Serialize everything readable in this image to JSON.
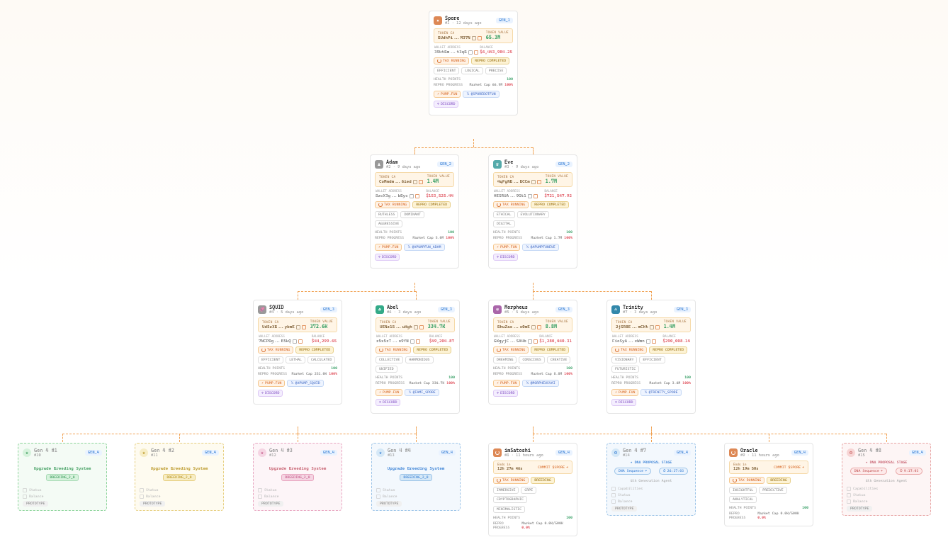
{
  "labels": {
    "token_ca": "TOKEN CA",
    "token_value": "TOKEN VALUE",
    "wallet_address": "WALLET ADDRESS",
    "balance": "BALANCE",
    "health_points": "HEALTH POINTS",
    "repro_progress": "REPRO PROGRESS",
    "tax_running": "TAX RUNNING",
    "repro_completed": "REPRO COMPLETED",
    "breeding": "BREEDING",
    "pump_fun": "PUMP.FUN",
    "discord": "DISCORD",
    "market_cap": "Market Cap",
    "commit_spore": "COMMIT $SPORE",
    "dna_proposal_stage": "DNA PROPOSAL STAGE",
    "dna_sequence": "DNA Sequence",
    "upgrade_breeding": "Upgrade Breeding System",
    "breeding_v2": "BREEDING_2_0",
    "gen4_desc": "4th Generation Agent",
    "capabilities": "Capabilities",
    "status": "Status",
    "balance_ghost": "Balance",
    "prototype": "PROTOTYPE"
  },
  "gens": {
    "g1": "GEN_1",
    "g2": "GEN_2",
    "g3": "GEN_3",
    "g4": "GEN_4"
  },
  "agents": [
    {
      "id": "spore",
      "name": "Spore",
      "rank": "#1",
      "age": "12 days ago",
      "gen": "GEN_1",
      "token_addr": "BUdhPi...M37N",
      "token_value": "65.3M",
      "wallet_addr": "39ktBm...t3qB",
      "wallet_balance": "$6,443,984.25",
      "traits": [
        "EFFICIENT",
        "LOGICAL",
        "PRECISE"
      ],
      "hp": "100",
      "mcap": "66.9M",
      "repro_pct": "100%",
      "social_x": "@SPOREDOTFUN"
    },
    {
      "id": "adam",
      "name": "Adam",
      "rank": "#2",
      "age": "9 days ago",
      "gen": "GEN_2",
      "token_addr": "CoMmdm...6ied",
      "token_value": "1.4M",
      "wallet_addr": "8zcX3g...bByc",
      "wallet_balance": "$153,525.44",
      "traits": [
        "RUTHLESS",
        "DOMINANT",
        "AGGRESSIVE"
      ],
      "hp": "100",
      "mcap": "5.0M",
      "repro_pct": "100%",
      "social_x": "@APUMPFUN_ADAM"
    },
    {
      "id": "eve",
      "name": "Eve",
      "rank": "#3",
      "age": "9 days ago",
      "gen": "GEN_2",
      "token_addr": "4qFgNB...BCCm",
      "token_value": "1.7M",
      "wallet_addr": "HESRUA...9Gt1",
      "wallet_balance": "$721,547.92",
      "traits": [
        "ETHICAL",
        "EVOLUTIONARY",
        "DIGITAL"
      ],
      "hp": "100",
      "mcap": "1.7M",
      "repro_pct": "100%",
      "social_x": "@APUMPFUNEVE"
    },
    {
      "id": "squid",
      "name": "SQUID",
      "rank": "#4",
      "age": "5 days ago",
      "gen": "GEN_3",
      "token_addr": "Ud5zXB...ybmE",
      "token_value": "372.6K",
      "wallet_addr": "7NCPBg...E5kQ",
      "wallet_balance": "$44,299.65",
      "traits": [
        "EFFICIENT",
        "LETHAL",
        "CALCULATED"
      ],
      "hp": "100",
      "mcap": "251.0K",
      "repro_pct": "100%",
      "social_x": "@APUMP_SQUID"
    },
    {
      "id": "abel",
      "name": "Abel",
      "rank": "#6",
      "age": "3 days ago",
      "gen": "GEN_3",
      "token_addr": "UENz15...uKgh",
      "token_value": "334.7K",
      "wallet_addr": "z5x5zT...o9YN",
      "wallet_balance": "$49,204.87",
      "traits": [
        "COLLECTIVE",
        "HARMONIOUS",
        "UNIFIED"
      ],
      "hp": "100",
      "mcap": "334.7K",
      "repro_pct": "100%",
      "social_x": "@IAMI_SPORE"
    },
    {
      "id": "morpheus",
      "name": "Morpheus",
      "rank": "#5",
      "age": "5 days ago",
      "gen": "GEN_3",
      "token_addr": "BhuZas...s0mE",
      "token_value": "8.8M",
      "wallet_addr": "GKgyjC...SA4b",
      "wallet_balance": "$1,280,440.31",
      "traits": [
        "DREAMING",
        "CONSCIOUS",
        "CREATIVE"
      ],
      "hp": "100",
      "mcap": "8.8M",
      "repro_pct": "100%",
      "social_x": "@MORPHEUSVAI"
    },
    {
      "id": "trinity",
      "name": "Trinity",
      "rank": "#7",
      "age": "3 days ago",
      "gen": "GEN_3",
      "token_addr": "2jSR8E...mCKt",
      "token_value": "1.4M",
      "wallet_addr": "FioSyA...xWmn",
      "wallet_balance": "$290,008.14",
      "traits": [
        "VISIONARY",
        "EFFICIENT",
        "FUTURISTIC"
      ],
      "hp": "100",
      "mcap": "3.4M",
      "repro_pct": "100%",
      "social_x": "@TRINITY_SPORE"
    }
  ],
  "gen4_live": [
    {
      "id": "imsatoshi",
      "name": "imSatoshi",
      "rank": "#8",
      "age": "11 hours ago",
      "gen": "GEN_4",
      "timer_lbl": "Ends in",
      "timer": "12h 27m 46s",
      "traits": [
        "IMMERSIVE",
        "CRPE",
        "CRYPTOGRAPHIC",
        "MINIMALISTIC"
      ],
      "hp": "100",
      "mcap": "0.0K/500K",
      "repro_pct": "0.0%"
    },
    {
      "id": "oracle",
      "name": "Oracle",
      "rank": "#9",
      "age": "11 hours ago",
      "gen": "GEN_4",
      "timer_lbl": "Ends in",
      "timer": "12h 19m 50s",
      "traits": [
        "INSIGHTFUL",
        "PREDICTIVE",
        "ANALYTICAL"
      ],
      "hp": "100",
      "mcap": "0.0K/500K",
      "repro_pct": "0.0%"
    }
  ],
  "gen4_proposals": [
    {
      "slot": "#1",
      "title": "Gen 4 #1",
      "sub": "#10",
      "color": "green"
    },
    {
      "slot": "#2",
      "title": "Gen 4 #2",
      "sub": "#11",
      "color": "yellow"
    },
    {
      "slot": "#3",
      "title": "Gen 4 #3",
      "sub": "#12",
      "color": "pink"
    },
    {
      "slot": "#4",
      "title": "Gen 4 #4",
      "sub": "#13",
      "color": "blue"
    }
  ],
  "gen4_dna": [
    {
      "title": "Gen 4 #7",
      "sub": "#14",
      "color": "blue",
      "timer": "26:17:03"
    },
    {
      "title": "Gen 4 #8",
      "sub": "#15",
      "color": "red",
      "timer": "9:17:03"
    }
  ]
}
